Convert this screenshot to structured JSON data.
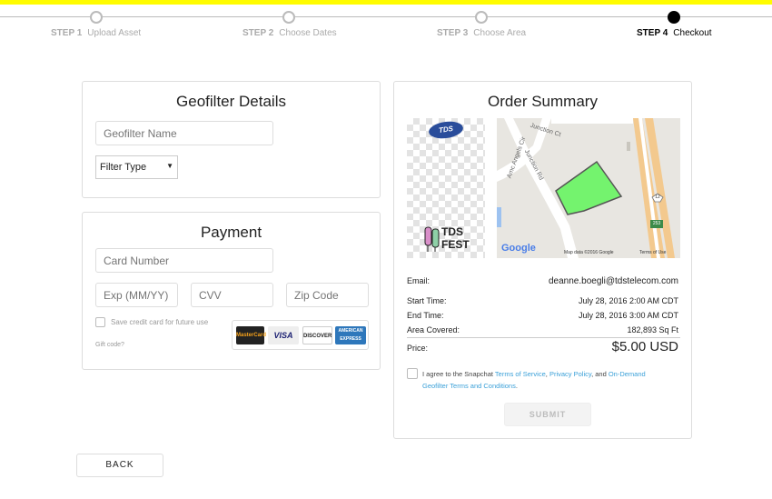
{
  "steps": [
    {
      "num": "STEP 1",
      "label": "Upload Asset"
    },
    {
      "num": "STEP 2",
      "label": "Choose Dates"
    },
    {
      "num": "STEP 3",
      "label": "Choose Area"
    },
    {
      "num": "STEP 4",
      "label": "Checkout"
    }
  ],
  "geofilter": {
    "title": "Geofilter Details",
    "name_placeholder": "Geofilter Name",
    "name_value": "",
    "filter_type": "Filter Type"
  },
  "payment": {
    "title": "Payment",
    "card_number_placeholder": "Card Number",
    "exp_placeholder": "Exp (MM/YY)",
    "cvv_placeholder": "CVV",
    "zip_placeholder": "Zip Code",
    "save_card_label": "Save credit card for future use",
    "gift_code": "Gift code?",
    "card_brands": [
      "MasterCard",
      "VISA",
      "DISCOVER",
      "AMERICAN EXPRESS"
    ]
  },
  "summary": {
    "title": "Order Summary",
    "asset_logo_text": "TDS",
    "asset_fest_text": "TDS FEST",
    "map": {
      "streets": [
        "Junction Ct",
        "Junction Rd",
        "Amc Angels Cir"
      ],
      "route_badges": [
        "12",
        "253"
      ],
      "google": "Google",
      "map_data": "Map data ©2016 Google",
      "terms": "Terms of Use"
    },
    "email_label": "Email:",
    "email_value": "deanne.boegli@tdstelecom.com",
    "start_label": "Start Time:",
    "start_value": "July 28, 2016 2:00 AM  CDT",
    "end_label": "End Time:",
    "end_value": "July 28, 2016 3:00 AM  CDT",
    "area_label": "Area Covered:",
    "area_value": "182,893 Sq Ft",
    "price_label": "Price:",
    "price_value": "$5.00 USD",
    "agree_prefix": "I agree to the Snapchat ",
    "terms_link": "Terms of Service",
    "sep1": ", ",
    "privacy_link": "Privacy Policy",
    "sep2": ", and ",
    "ondemand_link": "On-Demand Geofilter Terms and Conditions",
    "suffix": ".",
    "submit": "SUBMIT"
  },
  "back": "BACK",
  "colors": {
    "accent": "#fffc00",
    "link": "#3aa0d8",
    "polygon": "#74f36e"
  }
}
